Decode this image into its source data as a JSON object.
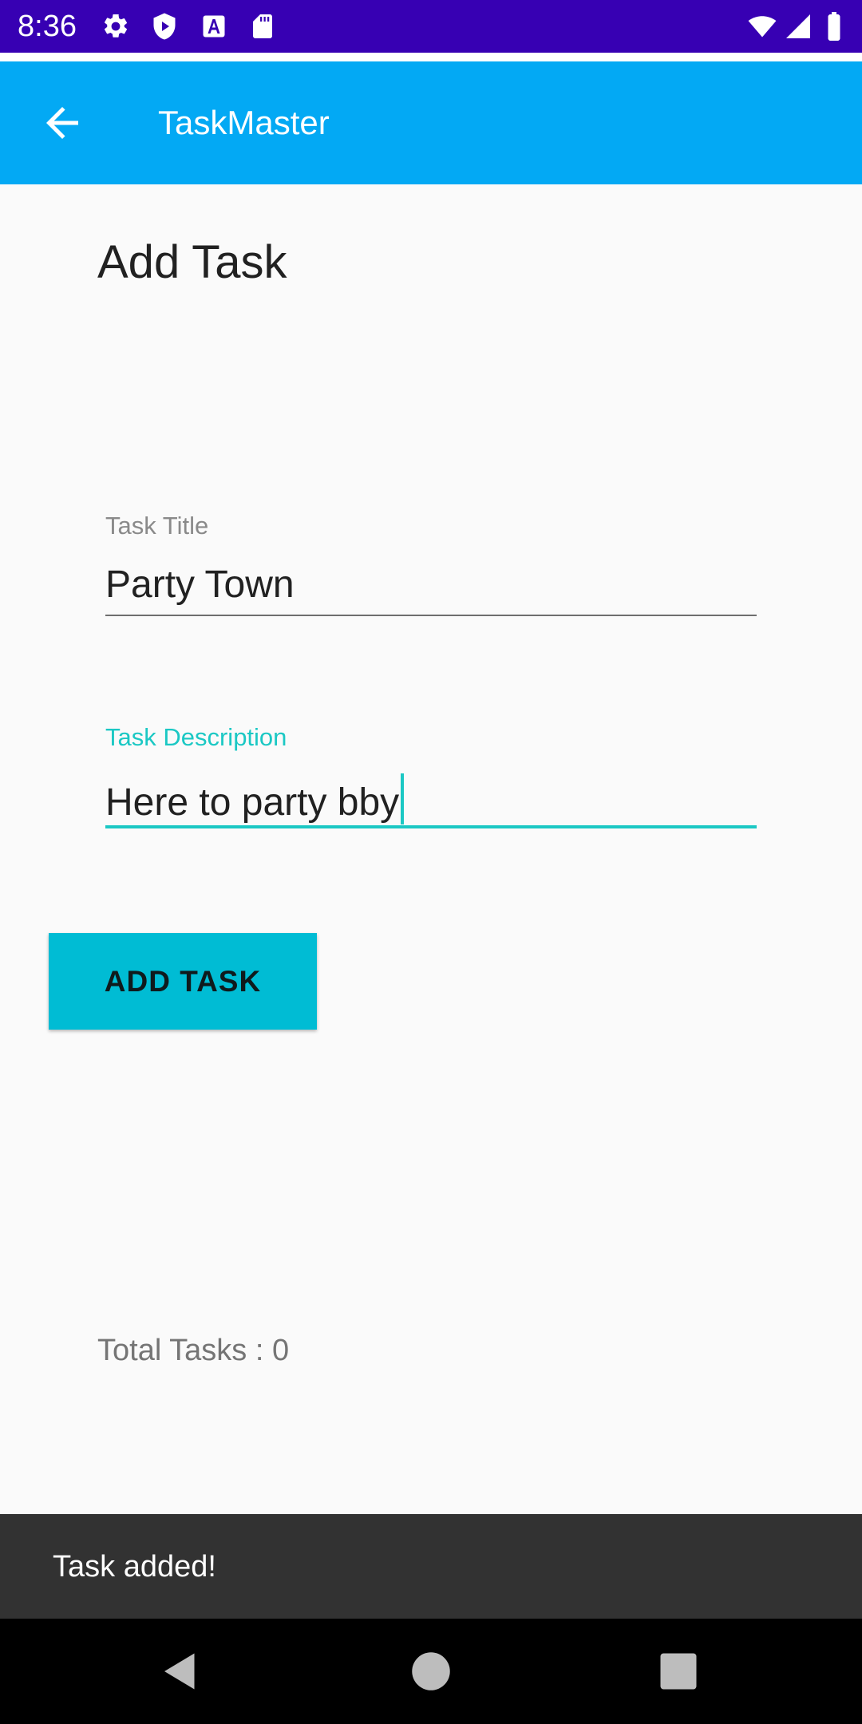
{
  "status_bar": {
    "time": "8:36",
    "left_icons": [
      "gear-icon",
      "shield-play-icon",
      "font-a-icon",
      "sd-card-icon"
    ],
    "right_icons": [
      "wifi-icon",
      "cell-signal-icon",
      "battery-icon"
    ],
    "color": "#3700b3"
  },
  "app_bar": {
    "title": "TaskMaster",
    "back_icon": "arrow-back-icon",
    "color": "#03a9f4"
  },
  "page": {
    "title": "Add Task"
  },
  "form": {
    "title_label": "Task Title",
    "title_value": "Party Town",
    "description_label": "Task Description",
    "description_value": "Here to party bby",
    "focus_color": "#1bc8c4"
  },
  "add_button": {
    "label": "ADD TASK",
    "color": "#00bcd4"
  },
  "summary": {
    "total_text": "Total Tasks : 0"
  },
  "snackbar": {
    "message": "Task added!"
  },
  "nav_bar": {
    "icons": [
      "back-triangle-icon",
      "home-circle-icon",
      "recents-square-icon"
    ]
  }
}
